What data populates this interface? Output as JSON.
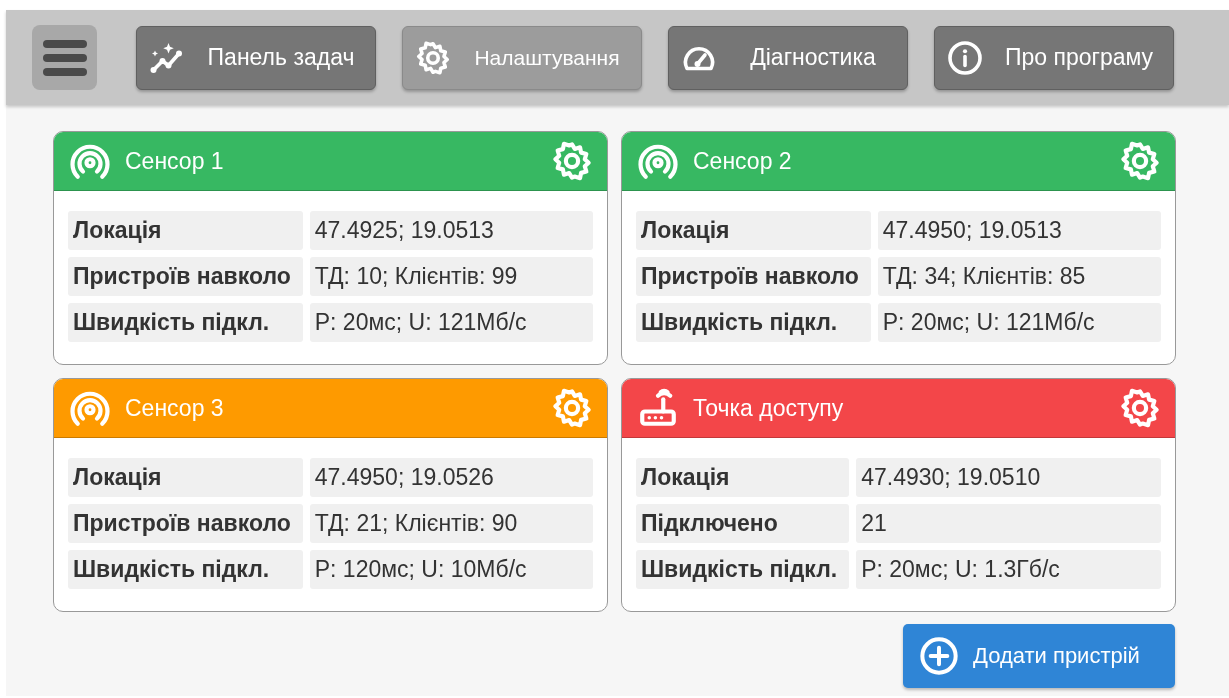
{
  "toolbar": {
    "menu": {
      "kind": "menu"
    },
    "buttons": [
      {
        "label": "Панель задач",
        "selected": false
      },
      {
        "label": "Налаштування",
        "selected": true
      },
      {
        "label": "Діагностика",
        "selected": false
      },
      {
        "label": "Про програму",
        "selected": false
      }
    ]
  },
  "devices": [
    {
      "title": "Сенсор 1",
      "kind": "sensor",
      "color": "#37b862",
      "rows": [
        {
          "label": "Локація",
          "value": "47.4925; 19.0513"
        },
        {
          "label": "Пристроїв навколо",
          "value": "ТД: 10; Клієнтів: 99"
        },
        {
          "label": "Швидкість підкл.",
          "value": "P: 20мс; U: 121Мб/с"
        }
      ]
    },
    {
      "title": "Сенсор 2",
      "kind": "sensor",
      "color": "#37b862",
      "rows": [
        {
          "label": "Локація",
          "value": "47.4950; 19.0513"
        },
        {
          "label": "Пристроїв навколо",
          "value": "ТД: 34; Клієнтів: 85"
        },
        {
          "label": "Швидкість підкл.",
          "value": "P: 20мс; U: 121Мб/с"
        }
      ]
    },
    {
      "title": "Сенсор 3",
      "kind": "sensor",
      "color": "#fe9a00",
      "rows": [
        {
          "label": "Локація",
          "value": "47.4950; 19.0526"
        },
        {
          "label": "Пристроїв навколо",
          "value": "ТД: 21; Клієнтів: 90"
        },
        {
          "label": "Швидкість підкл.",
          "value": "P: 120мс; U: 10Мб/с"
        }
      ]
    },
    {
      "title": "Точка доступу",
      "kind": "access_point",
      "color": "#f34649",
      "rows": [
        {
          "label": "Локація",
          "value": "47.4930; 19.0510"
        },
        {
          "label": "Підключено",
          "value": "21"
        },
        {
          "label": "Швидкість підкл.",
          "value": "P: 20мс; U: 1.3Гб/с"
        }
      ]
    }
  ],
  "add_button": {
    "label": "Додати пристрій"
  }
}
